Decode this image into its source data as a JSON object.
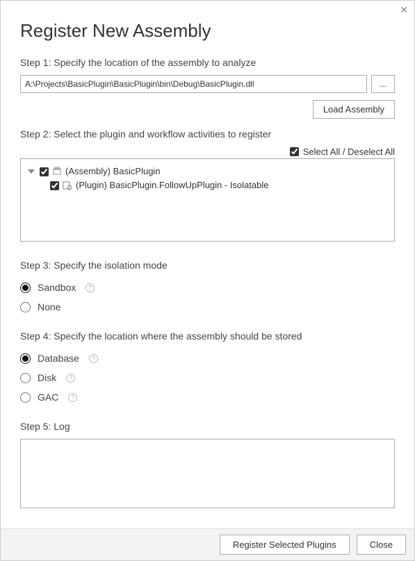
{
  "header": {
    "title": "Register New Assembly"
  },
  "step1": {
    "label": "Step 1: Specify the location of the assembly to analyze",
    "path": "A:\\Projects\\BasicPlugin\\BasicPlugin\\bin\\Debug\\BasicPlugin.dll",
    "browse_label": "...",
    "load_label": "Load Assembly"
  },
  "step2": {
    "label": "Step 2: Select the plugin and workflow activities to register",
    "select_all_label": "Select All / Deselect All",
    "select_all_checked": true,
    "tree": {
      "assembly": {
        "label": "(Assembly) BasicPlugin",
        "checked": true
      },
      "plugin": {
        "label": "(Plugin) BasicPlugin.FollowUpPlugin - Isolatable",
        "checked": true
      }
    }
  },
  "step3": {
    "label": "Step 3: Specify the isolation mode",
    "options": {
      "sandbox": "Sandbox",
      "none": "None"
    },
    "selected": "sandbox"
  },
  "step4": {
    "label": "Step 4: Specify the location where the assembly should be stored",
    "options": {
      "database": "Database",
      "disk": "Disk",
      "gac": "GAC"
    },
    "selected": "database"
  },
  "step5": {
    "label": "Step 5: Log"
  },
  "footer": {
    "register_label": "Register Selected Plugins",
    "close_label": "Close"
  }
}
